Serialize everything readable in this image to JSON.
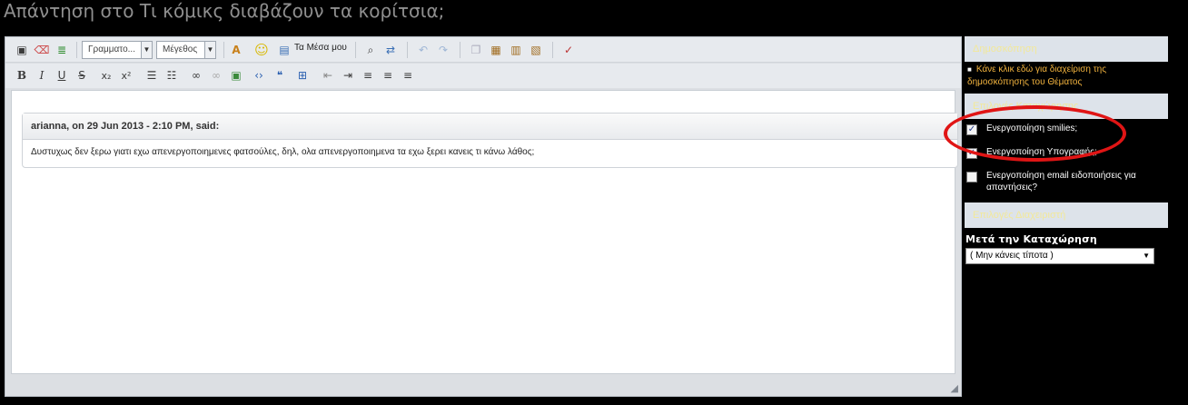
{
  "page_title": "Απάντηση στο Τι κόμικς διαβάζουν τα κορίτσια;",
  "toolbar": {
    "font_combo": "Γραμματο...",
    "size_combo": "Μέγεθος",
    "media_label": "Τα Μέσα μου"
  },
  "quote": {
    "header": "arianna, on 29 Jun 2013 - 2:10 PM, said:",
    "body": "Δυστυχως δεν ξερω γιατι εχω απενεργοποιημενες φατσούλες, δηλ, ολα απενεργοποιημενα τα εχω ξερει κανεις τι κάνω λάθος;"
  },
  "side": {
    "poll_header": "Δημοσκόπηση",
    "poll_link": "Κάνε κλικ εδώ για διαχείριση της δημοσκόπησης του Θέματος",
    "options_header": "Επιλογές Καταχώρησης",
    "options": [
      {
        "label": "Ενεργοποίηση smilies;",
        "checked": true
      },
      {
        "label": "Ενεργοποίηση Υπογραφής;",
        "checked": true
      },
      {
        "label": "Ενεργοποίηση email ειδοποιήσεις για απαντήσεις?",
        "checked": false
      }
    ],
    "mod_header": "Επιλογές Διαχειριστή",
    "after_label": "Μετά την Καταχώρηση",
    "after_select": "( Μην κάνεις τίποτα )"
  },
  "colors": {
    "background": "#000000",
    "link": "#f2b33e",
    "highlight_circle": "#e01515"
  }
}
